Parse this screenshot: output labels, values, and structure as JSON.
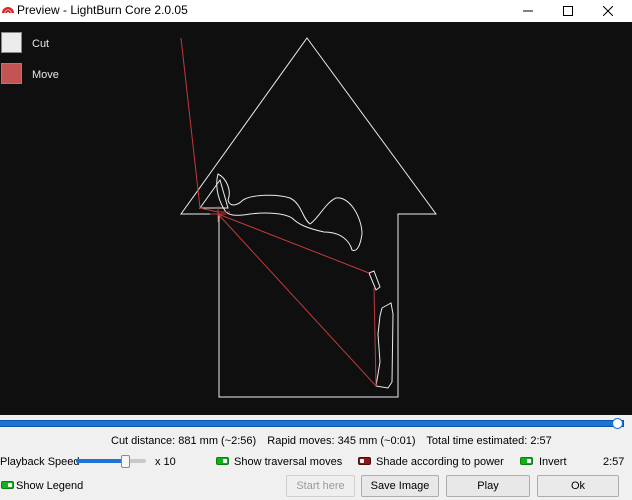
{
  "window": {
    "title": "Preview - LightBurn Core 2.0.05"
  },
  "legend": [
    {
      "label": "Cut",
      "color": "#ececec"
    },
    {
      "label": "Move",
      "color": "#c45454"
    }
  ],
  "playback": {
    "progress": 1.0,
    "speed_label": "Playback Speed",
    "speed_fraction": 0.7,
    "multiplier": "x 10",
    "time": "2:57"
  },
  "stats": {
    "cut_distance": "Cut distance: 881 mm (~2:56)",
    "rapid_moves": "Rapid moves: 345 mm (~0:01)",
    "total_time": "Total time estimated: 2:57"
  },
  "toggles": {
    "show_traversal": {
      "label": "Show traversal moves",
      "on": true
    },
    "shade_power": {
      "label": "Shade according to power",
      "on": false
    },
    "invert": {
      "label": "Invert",
      "on": true
    },
    "show_legend": {
      "label": "Show Legend",
      "on": true
    }
  },
  "buttons": {
    "start_here": "Start here",
    "save_image": "Save Image",
    "play": "Play",
    "ok": "Ok"
  },
  "colors": {
    "cut": "#ececec",
    "move": "#c03a3a",
    "canvas_bg": "#0f0f10",
    "accent": "#1e73d8"
  }
}
